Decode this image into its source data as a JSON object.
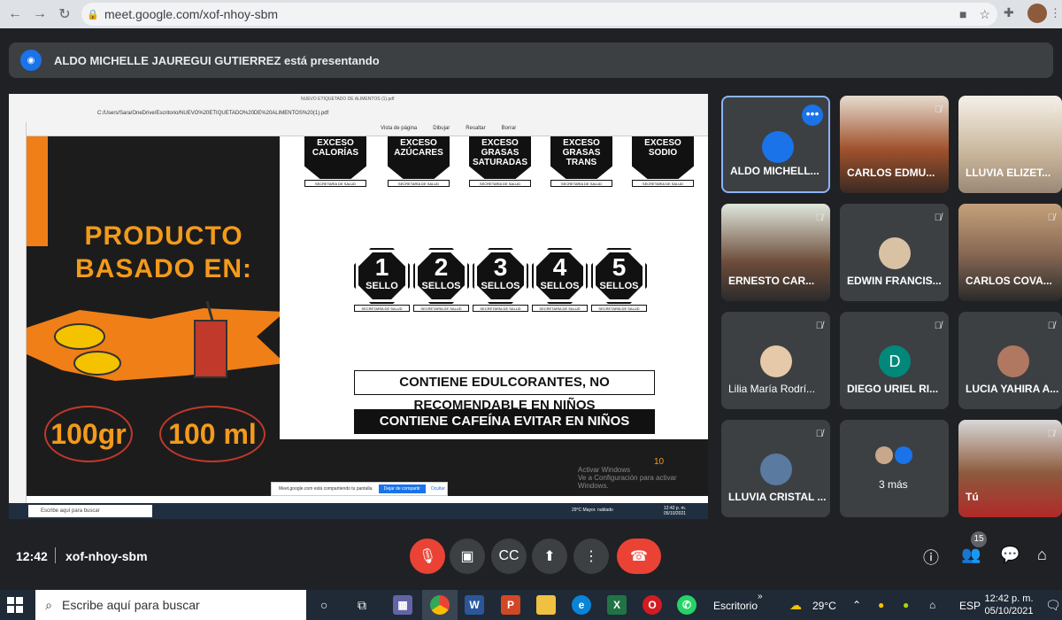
{
  "browser": {
    "url": "meet.google.com/xof-nhoy-sbm",
    "back_icon": "back-arrow-icon",
    "forward_icon": "forward-arrow-icon",
    "reload_icon": "reload-icon"
  },
  "banner": {
    "text": "ALDO MICHELLE JAUREGUI GUTIERREZ está presentando"
  },
  "shared_screen": {
    "pdf_title": "NUEVO ETIQUETADO DE ALIMENTOS (1).pdf",
    "pdf_path": "C:/Users/Sara/OneDrive/Escritorio/NUEVO%20ETIQUETADO%20DE%20ALIMENTOS%20(1).pdf",
    "tools": [
      "Vista de página",
      "Dibujar",
      "Resaltar",
      "Borrar"
    ],
    "left_heading_1": "PRODUCTO",
    "left_heading_2": "BASADO EN:",
    "qty_1": "100gr",
    "qty_2": "100 ml",
    "top_seals": [
      {
        "text": "EXCESO CALORÍAS",
        "label": "SECRETARÍA DE SALUD"
      },
      {
        "text": "EXCESO AZÚCARES",
        "label": "SECRETARÍA DE SALUD"
      },
      {
        "text": "EXCESO GRASAS SATURADAS",
        "label": "SECRETARÍA DE SALUD"
      },
      {
        "text": "EXCESO GRASAS TRANS",
        "label": "SECRETARÍA DE SALUD"
      },
      {
        "text": "EXCESO SODIO",
        "label": "SECRETARÍA DE SALUD"
      }
    ],
    "seals": [
      {
        "num": "1",
        "word": "SELLO",
        "label": "SECRETARÍA DE SALUD"
      },
      {
        "num": "2",
        "word": "SELLOS",
        "label": "SECRETARÍA DE SALUD"
      },
      {
        "num": "3",
        "word": "SELLOS",
        "label": "SECRETARÍA DE SALUD"
      },
      {
        "num": "4",
        "word": "SELLOS",
        "label": "SECRETARÍA DE SALUD"
      },
      {
        "num": "5",
        "word": "SELLOS",
        "label": "SECRETARÍA DE SALUD"
      }
    ],
    "warning_1": "CONTIENE EDULCORANTES, NO RECOMENDABLE EN NIÑOS",
    "warning_2": "CONTIENE CAFEÍNA EVITAR EN NIÑOS",
    "page_number": "10",
    "activate_1": "Activar Windows",
    "activate_2": "Ve a Configuración para activar Windows.",
    "share_note": "Meet.google.com está compartiendo tu pantalla.",
    "stop_share": "Dejar de compartir",
    "hide": "Ocultar",
    "inner_search": "Escribe aquí para buscar",
    "inner_weather": "29°C Mayor. nublado",
    "inner_time": "12:42 p. m.",
    "inner_date": "05/10/2021"
  },
  "participants": [
    {
      "name": "ALDO MICHELL...",
      "avatar_color": "#1a73e8"
    },
    {
      "name": "CARLOS EDMU...",
      "avatar_color": "#a0522d"
    },
    {
      "name": "LLUVIA ELIZET...",
      "avatar_color": "#c8b59a"
    },
    {
      "name": "ERNESTO CAR...",
      "avatar_color": "#6d4c3a"
    },
    {
      "name": "EDWIN FRANCIS...",
      "avatar_color": "#d9c2a3"
    },
    {
      "name": "CARLOS COVA...",
      "avatar_color": "#8a6a55"
    },
    {
      "name": "Lilia María Rodrí...",
      "avatar_color": "#e6c9a8"
    },
    {
      "name": "DIEGO URIEL RI...",
      "avatar_color": "#00897b",
      "initial": "D"
    },
    {
      "name": "LUCIA YAHIRA A...",
      "avatar_color": "#b07860"
    },
    {
      "name": "LLUVIA CRISTAL ...",
      "avatar_color": "#5a7aa0"
    },
    {
      "name": "3 más",
      "avatar_color": "#5f6368"
    },
    {
      "name": "Tú",
      "avatar_color": "#8d5a3c"
    }
  ],
  "bottom": {
    "time": "12:42",
    "meeting_code": "xof-nhoy-sbm",
    "participant_count": "15"
  },
  "taskbar": {
    "search_placeholder": "Escribe aquí para buscar",
    "desktop_label": "Escritorio",
    "weather": "29°C",
    "language": "ESP",
    "time": "12:42 p. m.",
    "date": "05/10/2021"
  }
}
